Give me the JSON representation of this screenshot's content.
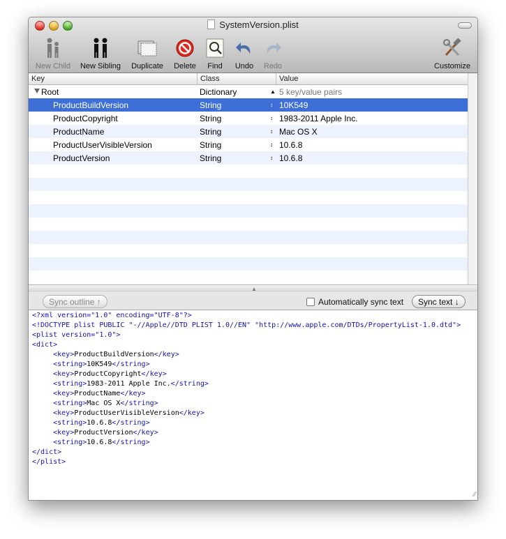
{
  "window": {
    "title": "SystemVersion.plist"
  },
  "toolbar": {
    "new_child": "New Child",
    "new_sibling": "New Sibling",
    "duplicate": "Duplicate",
    "delete": "Delete",
    "find": "Find",
    "undo": "Undo",
    "redo": "Redo",
    "customize": "Customize"
  },
  "columns": {
    "key": "Key",
    "class": "Class",
    "value": "Value"
  },
  "root": {
    "key": "Root",
    "class": "Dictionary",
    "value": "5 key/value pairs"
  },
  "rows": [
    {
      "key": "ProductBuildVersion",
      "class": "String",
      "value": "10K549"
    },
    {
      "key": "ProductCopyright",
      "class": "String",
      "value": "1983-2011 Apple Inc."
    },
    {
      "key": "ProductName",
      "class": "String",
      "value": "Mac OS X"
    },
    {
      "key": "ProductUserVisibleVersion",
      "class": "String",
      "value": "10.6.8"
    },
    {
      "key": "ProductVersion",
      "class": "String",
      "value": "10.6.8"
    }
  ],
  "sync": {
    "outline_label": "Sync outline ↑",
    "auto_label": "Automatically sync text",
    "text_label": "Sync text ↓"
  },
  "xml_lines": [
    {
      "parts": [
        [
          "tag",
          "<?xml version=\"1.0\" encoding=\"UTF-8\"?>"
        ]
      ]
    },
    {
      "parts": [
        [
          "tag",
          "<!DOCTYPE plist PUBLIC \"-//Apple//DTD PLIST 1.0//EN\" \"http://www.apple.com/DTDs/PropertyList-1.0.dtd\">"
        ]
      ]
    },
    {
      "parts": [
        [
          "tag",
          "<plist version=\"1.0\">"
        ]
      ]
    },
    {
      "parts": [
        [
          "tag",
          "<dict>"
        ]
      ]
    },
    {
      "parts": [
        [
          "txt",
          "     "
        ],
        [
          "tag",
          "<key>"
        ],
        [
          "txt",
          "ProductBuildVersion"
        ],
        [
          "tag",
          "</key>"
        ]
      ]
    },
    {
      "parts": [
        [
          "txt",
          "     "
        ],
        [
          "tag",
          "<string>"
        ],
        [
          "txt",
          "10K549"
        ],
        [
          "tag",
          "</string>"
        ]
      ]
    },
    {
      "parts": [
        [
          "txt",
          "     "
        ],
        [
          "tag",
          "<key>"
        ],
        [
          "txt",
          "ProductCopyright"
        ],
        [
          "tag",
          "</key>"
        ]
      ]
    },
    {
      "parts": [
        [
          "txt",
          "     "
        ],
        [
          "tag",
          "<string>"
        ],
        [
          "txt",
          "1983-2011 Apple Inc."
        ],
        [
          "tag",
          "</string>"
        ]
      ]
    },
    {
      "parts": [
        [
          "txt",
          "     "
        ],
        [
          "tag",
          "<key>"
        ],
        [
          "txt",
          "ProductName"
        ],
        [
          "tag",
          "</key>"
        ]
      ]
    },
    {
      "parts": [
        [
          "txt",
          "     "
        ],
        [
          "tag",
          "<string>"
        ],
        [
          "txt",
          "Mac OS X"
        ],
        [
          "tag",
          "</string>"
        ]
      ]
    },
    {
      "parts": [
        [
          "txt",
          "     "
        ],
        [
          "tag",
          "<key>"
        ],
        [
          "txt",
          "ProductUserVisibleVersion"
        ],
        [
          "tag",
          "</key>"
        ]
      ]
    },
    {
      "parts": [
        [
          "txt",
          "     "
        ],
        [
          "tag",
          "<string>"
        ],
        [
          "txt",
          "10.6.8"
        ],
        [
          "tag",
          "</string>"
        ]
      ]
    },
    {
      "parts": [
        [
          "txt",
          "     "
        ],
        [
          "tag",
          "<key>"
        ],
        [
          "txt",
          "ProductVersion"
        ],
        [
          "tag",
          "</key>"
        ]
      ]
    },
    {
      "parts": [
        [
          "txt",
          "     "
        ],
        [
          "tag",
          "<string>"
        ],
        [
          "txt",
          "10.6.8"
        ],
        [
          "tag",
          "</string>"
        ]
      ]
    },
    {
      "parts": [
        [
          "tag",
          "</dict>"
        ]
      ]
    },
    {
      "parts": [
        [
          "tag",
          "</plist>"
        ]
      ]
    }
  ]
}
